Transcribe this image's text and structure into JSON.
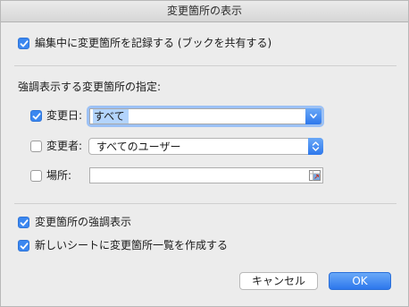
{
  "window": {
    "title": "変更箇所の表示"
  },
  "track_changes": {
    "label": "編集中に変更箇所を記録する (ブックを共有する)",
    "checked": true
  },
  "highlight_section": {
    "heading": "強調表示する変更箇所の指定:",
    "when": {
      "label": "変更日:",
      "checked": true,
      "value": "すべて"
    },
    "who": {
      "label": "変更者:",
      "checked": false,
      "value": "すべてのユーザー"
    },
    "where": {
      "label": "場所:",
      "checked": false,
      "value": "",
      "icon": "range-select-icon"
    }
  },
  "options": {
    "highlight_on_screen": {
      "label": "変更箇所の強調表示",
      "checked": true
    },
    "list_on_new_sheet": {
      "label": "新しいシートに変更箇所一覧を作成する",
      "checked": true
    }
  },
  "buttons": {
    "cancel": "キャンセル",
    "ok": "OK"
  },
  "colors": {
    "accent": "#3b87f0",
    "background": "#ececec"
  }
}
